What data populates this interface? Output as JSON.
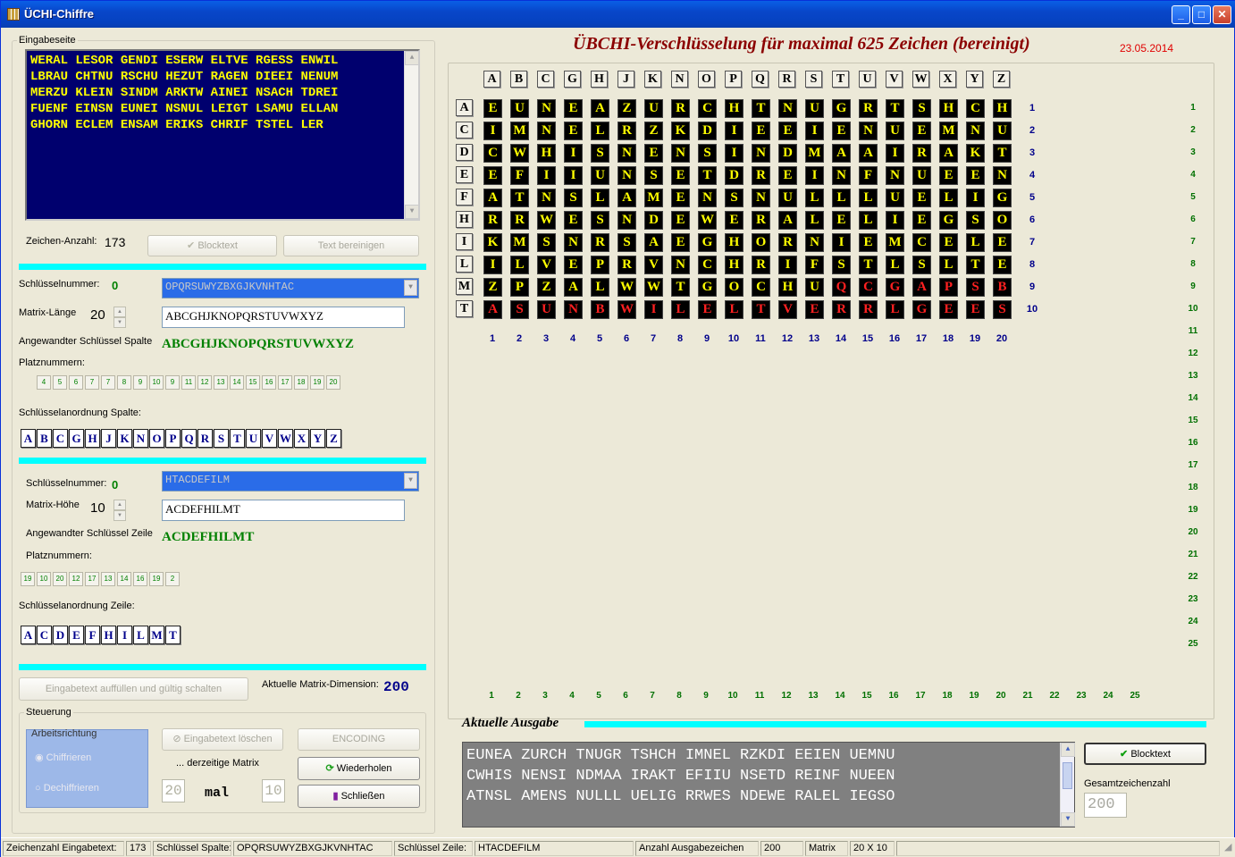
{
  "window": {
    "title": "ÜCHI-Chiffre"
  },
  "input": {
    "group_label": "Eingabeseite",
    "lines": [
      "WERAL LESOR GENDI ESERW ELTVE RGESS ENWIL",
      "LBRAU CHTNU RSCHU HEZUT RAGEN DIEEI NENUM",
      "MERZU KLEIN SINDM ARKTW AINEI NSACH TDREI",
      "FUENF EINSN EUNEI NSNUL LEIGT LSAMU ELLAN",
      "GHORN ECLEM ENSAM ERIKS CHRIF TSTEL LER"
    ],
    "count_label": "Zeichen-Anzahl:",
    "count": "173",
    "blocktext_btn": "Blocktext",
    "clean_btn": "Text bereinigen"
  },
  "col_key": {
    "keynum_label": "Schlüsselnummer:",
    "keynum": "0",
    "combo_value": "OPQRSUWYZBXGJKVNHTAC",
    "len_label": "Matrix-Länge",
    "len": "20",
    "edit_value": "ABCGHJKNOPQRSTUVWXYZ",
    "applied_label": "Angewandter Schlüssel Spalte",
    "applied": "ABCGHJKNOPQRSTUVWXYZ",
    "places_label": "Platznummern:",
    "places": [
      "4",
      "5",
      "6",
      "7",
      "7",
      "8",
      "9",
      "10",
      "9",
      "11",
      "12",
      "13",
      "14",
      "15",
      "16",
      "17",
      "18",
      "19",
      "20"
    ],
    "order_label": "Schlüsselanordnung Spalte:",
    "order": [
      "A",
      "B",
      "C",
      "G",
      "H",
      "J",
      "K",
      "N",
      "O",
      "P",
      "Q",
      "R",
      "S",
      "T",
      "U",
      "V",
      "W",
      "X",
      "Y",
      "Z"
    ]
  },
  "row_key": {
    "keynum_label": "Schlüsselnummer:",
    "keynum": "0",
    "combo_value": "HTACDEFILM",
    "height_label": "Matrix-Höhe",
    "height": "10",
    "edit_value": "ACDEFHILMT",
    "applied_label": "Angewandter Schlüssel Zeile",
    "applied": "ACDEFHILMT",
    "places_label": "Platznummern:",
    "places": [
      "19",
      "10",
      "20",
      "12",
      "17",
      "13",
      "14",
      "16",
      "19",
      "2"
    ],
    "order_label": "Schlüsselanordnung Zeile:",
    "order": [
      "A",
      "C",
      "D",
      "E",
      "F",
      "H",
      "I",
      "L",
      "M",
      "T"
    ]
  },
  "fill_btn": "Eingabetext auffüllen und gültig schalten",
  "dim_label": "Aktuelle Matrix-Dimension:",
  "dim_value": "200",
  "control": {
    "group_label": "Steuerung",
    "dir_label": "Arbeitsrichtung",
    "encrypt": "Chiffrieren",
    "decrypt": "Dechiffrieren",
    "delete_btn": "Eingabetext löschen",
    "encoding_btn": "ENCODING",
    "current_matrix": "... derzeitige Matrix",
    "repeat_btn": "Wiederholen",
    "close_btn": "Schließen",
    "m1": "20",
    "times": "mal",
    "m2": "10"
  },
  "main": {
    "title": "ÜBCHI-Verschlüsselung für maximal 625 Zeichen (bereinigt)",
    "date": "23.05.2014",
    "col_headers": [
      "A",
      "B",
      "C",
      "G",
      "H",
      "J",
      "K",
      "N",
      "O",
      "P",
      "Q",
      "R",
      "S",
      "T",
      "U",
      "V",
      "W",
      "X",
      "Y",
      "Z"
    ],
    "row_headers": [
      "A",
      "C",
      "D",
      "E",
      "F",
      "H",
      "I",
      "L",
      "M",
      "T"
    ],
    "matrix": [
      "EUNEAZURCHTNUGRTSHCH",
      "IMNELRZKDIEEIENUEMNU",
      "CWHISNENSINDMAAIRAKT",
      "EFIIUNSETDREINFNUEEN",
      "ATNSLAMENSNULLLUELIG",
      "RRWESNDEWERALELIEGSO",
      "KMSNRSAEGHORNIEMCELE",
      "ILVEPRVNCHRIFSTLSLTE",
      "ZPZALWWTGOCHUQCGAPSB",
      "TASUNBWILELTVERRLGEES"
    ],
    "red_from_row8_col": 13,
    "row_numbers": [
      "1",
      "2",
      "3",
      "4",
      "5",
      "6",
      "7",
      "8",
      "9",
      "10"
    ],
    "col_numbers": [
      "1",
      "2",
      "3",
      "4",
      "5",
      "6",
      "7",
      "8",
      "9",
      "10",
      "11",
      "12",
      "13",
      "14",
      "15",
      "16",
      "17",
      "18",
      "19",
      "20"
    ],
    "side_numbers": [
      "1",
      "2",
      "3",
      "4",
      "5",
      "6",
      "7",
      "8",
      "9",
      "10",
      "11",
      "12",
      "13",
      "14",
      "15",
      "16",
      "17",
      "18",
      "19",
      "20",
      "21",
      "22",
      "23",
      "24",
      "25"
    ],
    "bottom_numbers": [
      "1",
      "2",
      "3",
      "4",
      "5",
      "6",
      "7",
      "8",
      "9",
      "10",
      "11",
      "12",
      "13",
      "14",
      "15",
      "16",
      "17",
      "18",
      "19",
      "20",
      "21",
      "22",
      "23",
      "24",
      "25"
    ]
  },
  "output": {
    "label": "Aktuelle Ausgabe",
    "lines": [
      "EUNEA ZURCH TNUGR TSHCH IMNEL RZKDI EEIEN UEMNU",
      "CWHIS NENSI NDMAA IRAKT EFIIU NSETD REINF NUEEN",
      "ATNSL AMENS NULLL UELIG RRWES NDEWE RALEL IEGSO"
    ],
    "blocktext_btn": "Blocktext",
    "total_label": "Gesamtzeichenzahl",
    "total": "200"
  },
  "status": {
    "s1": "Zeichenzahl Eingabetext:",
    "s2": "173",
    "s3": "Schlüssel Spalte:",
    "s4": "OPQRSUWYZBXGJKVNHTAC",
    "s5": "Schlüssel Zeile:",
    "s6": "HTACDEFILM",
    "s7": "Anzahl Ausgabezeichen",
    "s8": "200",
    "s9": "Matrix",
    "s10": "20 X 10"
  },
  "colors": {
    "accent": "#00FFFF",
    "memo_bg": "#00006E",
    "memo_fg": "#FFFF00",
    "title_red": "#8B0000"
  }
}
